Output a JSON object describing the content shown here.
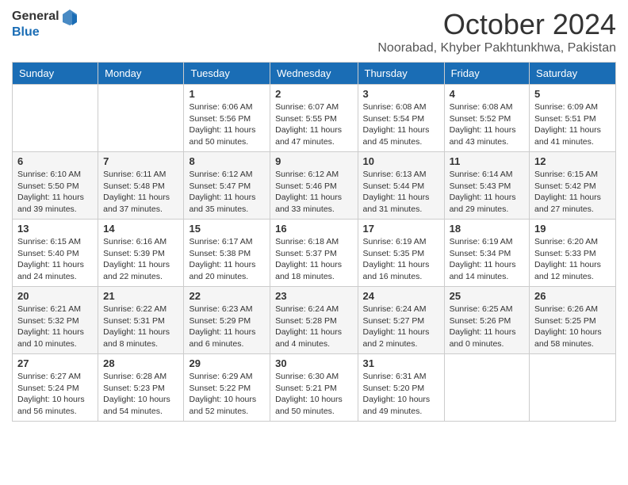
{
  "logo": {
    "general": "General",
    "blue": "Blue"
  },
  "header": {
    "month": "October 2024",
    "location": "Noorabad, Khyber Pakhtunkhwa, Pakistan"
  },
  "weekdays": [
    "Sunday",
    "Monday",
    "Tuesday",
    "Wednesday",
    "Thursday",
    "Friday",
    "Saturday"
  ],
  "weeks": [
    [
      {
        "day": "",
        "info": ""
      },
      {
        "day": "",
        "info": ""
      },
      {
        "day": "1",
        "info": "Sunrise: 6:06 AM\nSunset: 5:56 PM\nDaylight: 11 hours and 50 minutes."
      },
      {
        "day": "2",
        "info": "Sunrise: 6:07 AM\nSunset: 5:55 PM\nDaylight: 11 hours and 47 minutes."
      },
      {
        "day": "3",
        "info": "Sunrise: 6:08 AM\nSunset: 5:54 PM\nDaylight: 11 hours and 45 minutes."
      },
      {
        "day": "4",
        "info": "Sunrise: 6:08 AM\nSunset: 5:52 PM\nDaylight: 11 hours and 43 minutes."
      },
      {
        "day": "5",
        "info": "Sunrise: 6:09 AM\nSunset: 5:51 PM\nDaylight: 11 hours and 41 minutes."
      }
    ],
    [
      {
        "day": "6",
        "info": "Sunrise: 6:10 AM\nSunset: 5:50 PM\nDaylight: 11 hours and 39 minutes."
      },
      {
        "day": "7",
        "info": "Sunrise: 6:11 AM\nSunset: 5:48 PM\nDaylight: 11 hours and 37 minutes."
      },
      {
        "day": "8",
        "info": "Sunrise: 6:12 AM\nSunset: 5:47 PM\nDaylight: 11 hours and 35 minutes."
      },
      {
        "day": "9",
        "info": "Sunrise: 6:12 AM\nSunset: 5:46 PM\nDaylight: 11 hours and 33 minutes."
      },
      {
        "day": "10",
        "info": "Sunrise: 6:13 AM\nSunset: 5:44 PM\nDaylight: 11 hours and 31 minutes."
      },
      {
        "day": "11",
        "info": "Sunrise: 6:14 AM\nSunset: 5:43 PM\nDaylight: 11 hours and 29 minutes."
      },
      {
        "day": "12",
        "info": "Sunrise: 6:15 AM\nSunset: 5:42 PM\nDaylight: 11 hours and 27 minutes."
      }
    ],
    [
      {
        "day": "13",
        "info": "Sunrise: 6:15 AM\nSunset: 5:40 PM\nDaylight: 11 hours and 24 minutes."
      },
      {
        "day": "14",
        "info": "Sunrise: 6:16 AM\nSunset: 5:39 PM\nDaylight: 11 hours and 22 minutes."
      },
      {
        "day": "15",
        "info": "Sunrise: 6:17 AM\nSunset: 5:38 PM\nDaylight: 11 hours and 20 minutes."
      },
      {
        "day": "16",
        "info": "Sunrise: 6:18 AM\nSunset: 5:37 PM\nDaylight: 11 hours and 18 minutes."
      },
      {
        "day": "17",
        "info": "Sunrise: 6:19 AM\nSunset: 5:35 PM\nDaylight: 11 hours and 16 minutes."
      },
      {
        "day": "18",
        "info": "Sunrise: 6:19 AM\nSunset: 5:34 PM\nDaylight: 11 hours and 14 minutes."
      },
      {
        "day": "19",
        "info": "Sunrise: 6:20 AM\nSunset: 5:33 PM\nDaylight: 11 hours and 12 minutes."
      }
    ],
    [
      {
        "day": "20",
        "info": "Sunrise: 6:21 AM\nSunset: 5:32 PM\nDaylight: 11 hours and 10 minutes."
      },
      {
        "day": "21",
        "info": "Sunrise: 6:22 AM\nSunset: 5:31 PM\nDaylight: 11 hours and 8 minutes."
      },
      {
        "day": "22",
        "info": "Sunrise: 6:23 AM\nSunset: 5:29 PM\nDaylight: 11 hours and 6 minutes."
      },
      {
        "day": "23",
        "info": "Sunrise: 6:24 AM\nSunset: 5:28 PM\nDaylight: 11 hours and 4 minutes."
      },
      {
        "day": "24",
        "info": "Sunrise: 6:24 AM\nSunset: 5:27 PM\nDaylight: 11 hours and 2 minutes."
      },
      {
        "day": "25",
        "info": "Sunrise: 6:25 AM\nSunset: 5:26 PM\nDaylight: 11 hours and 0 minutes."
      },
      {
        "day": "26",
        "info": "Sunrise: 6:26 AM\nSunset: 5:25 PM\nDaylight: 10 hours and 58 minutes."
      }
    ],
    [
      {
        "day": "27",
        "info": "Sunrise: 6:27 AM\nSunset: 5:24 PM\nDaylight: 10 hours and 56 minutes."
      },
      {
        "day": "28",
        "info": "Sunrise: 6:28 AM\nSunset: 5:23 PM\nDaylight: 10 hours and 54 minutes."
      },
      {
        "day": "29",
        "info": "Sunrise: 6:29 AM\nSunset: 5:22 PM\nDaylight: 10 hours and 52 minutes."
      },
      {
        "day": "30",
        "info": "Sunrise: 6:30 AM\nSunset: 5:21 PM\nDaylight: 10 hours and 50 minutes."
      },
      {
        "day": "31",
        "info": "Sunrise: 6:31 AM\nSunset: 5:20 PM\nDaylight: 10 hours and 49 minutes."
      },
      {
        "day": "",
        "info": ""
      },
      {
        "day": "",
        "info": ""
      }
    ]
  ]
}
